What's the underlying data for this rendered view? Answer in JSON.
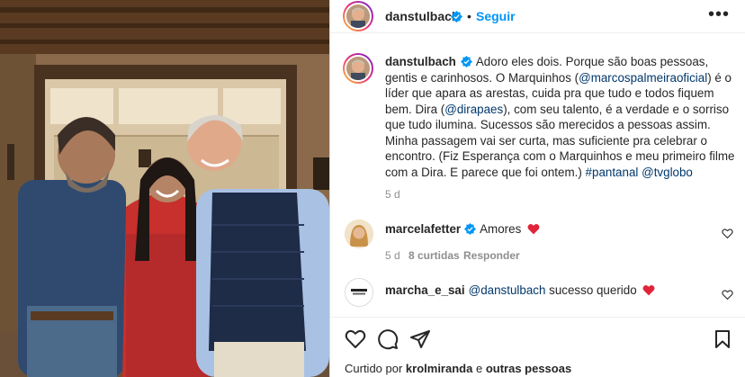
{
  "post": {
    "username": "danstulbach",
    "follow_label": "Seguir",
    "more_label": "•••",
    "caption_user": "danstulbach",
    "caption": [
      {
        "t": "Adoro eles dois. Porque são boas pessoas, gentis e carinhosos. O Marquinhos (",
        "link": false
      },
      {
        "t": "@marcospalmeiraoficial",
        "link": true
      },
      {
        "t": ") é o líder que apara as arestas, cuida pra que tudo e todos fiquem bem. Dira (",
        "link": false
      },
      {
        "t": "@dirapaes",
        "link": true
      },
      {
        "t": "), com seu talento, é a verdade e o sorriso que tudo ilumina. Sucessos são merecidos a pessoas assim. Minha passagem vai ser curta, mas suficiente pra celebrar o encontro. (Fiz Esperança com o Marquinhos e meu primeiro filme com a Dira. E parece que foi ontem.) ",
        "link": false
      },
      {
        "t": "#pantanal",
        "link": true
      },
      {
        "t": " ",
        "link": false
      },
      {
        "t": "@tvglobo",
        "link": true
      }
    ],
    "caption_age": "5 d"
  },
  "comments": [
    {
      "username": "marcelafetter",
      "verified": true,
      "text": "Amores",
      "age": "5 d",
      "likes": "8 curtidas",
      "reply": "Responder"
    },
    {
      "username": "marcha_e_sai",
      "verified": false,
      "mention": "@danstulbach",
      "text": " sucesso querido"
    }
  ],
  "footer": {
    "liked_by_prefix": "Curtido por ",
    "liked_by_user": "krolmiranda",
    "liked_by_mid": " e ",
    "liked_by_rest": "outras pessoas"
  },
  "colors": {
    "link": "#00376b",
    "accent": "#0095f6",
    "heart": "#ed4956",
    "verified": "#0095f6"
  }
}
